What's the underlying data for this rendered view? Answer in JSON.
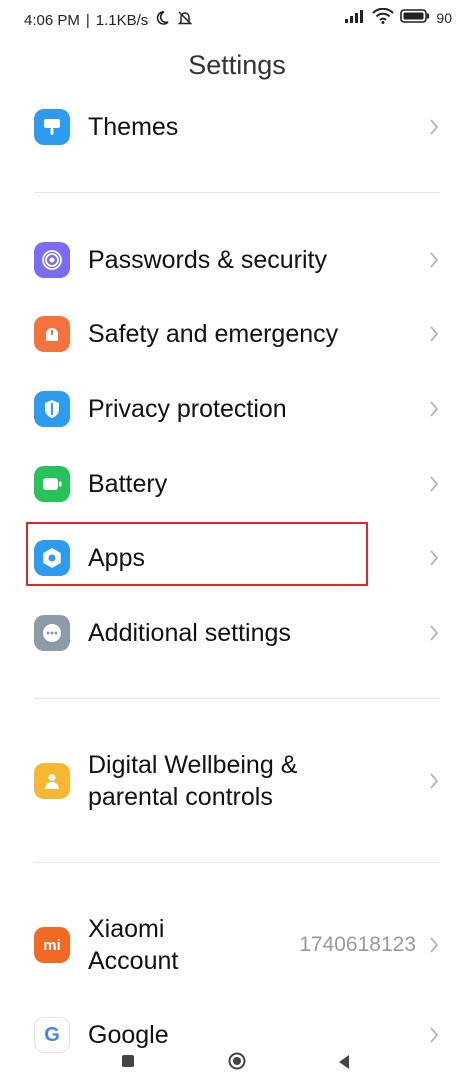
{
  "status_bar": {
    "time": "4:06 PM",
    "speed": "1.1KB/s",
    "battery": "90"
  },
  "header": {
    "title": "Settings"
  },
  "items": [
    {
      "label": "Themes",
      "icon": "themes-icon",
      "color": "#2d9bf0"
    },
    {
      "label": "Passwords & security",
      "icon": "fingerprint-icon",
      "color": "#7b6cf6"
    },
    {
      "label": "Safety and emergency",
      "icon": "emergency-icon",
      "color": "#f4733d"
    },
    {
      "label": "Privacy protection",
      "icon": "privacy-icon",
      "color": "#2d9bf0"
    },
    {
      "label": "Battery",
      "icon": "battery-icon",
      "color": "#27c35a"
    },
    {
      "label": "Apps",
      "icon": "apps-gear-icon",
      "color": "#2d9bf0"
    },
    {
      "label": "Additional settings",
      "icon": "more-dots-icon",
      "color": "#8e9aa8"
    },
    {
      "label": "Digital Wellbeing & parental controls",
      "icon": "wellbeing-icon",
      "color": "#f7b731"
    },
    {
      "label": "Xiaomi Account",
      "value": "1740618123",
      "icon": "mi-logo-icon",
      "color": "#f26a21"
    },
    {
      "label": "Google",
      "icon": "google-icon",
      "color": "#ffffff"
    }
  ],
  "highlight_color": "#e1252f"
}
